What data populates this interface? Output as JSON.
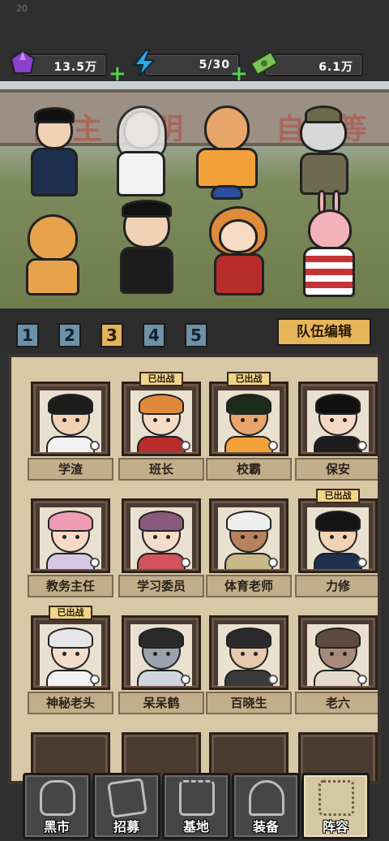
{
  "status_bar": {
    "time_fragment": "20"
  },
  "resources": [
    {
      "icon": "gem-icon",
      "value": "13.5万",
      "color": "#8b3fcf"
    },
    {
      "icon": "lightning-icon",
      "value": "5/30",
      "color": "#2fa8e6"
    },
    {
      "icon": "cash-icon",
      "value": "6.1万",
      "color": "#5aa84a"
    }
  ],
  "scene": {
    "wall_text_left": "民主",
    "wall_text_mid": "明 利",
    "wall_text_right": "自  等"
  },
  "team_tabs": [
    "1",
    "2",
    "3",
    "4",
    "5"
  ],
  "active_team": "3",
  "edit_team_label": "队伍编辑",
  "roster": [
    {
      "name": "学渣",
      "deployed": false,
      "skin": "#f1d2b5",
      "hair": "#1d1d1d",
      "shirt": "#f2f2f2"
    },
    {
      "name": "班长",
      "deployed": true,
      "badge": "已出战",
      "skin": "#f6dcc4",
      "hair": "#e08a3c",
      "shirt": "#b82c2c"
    },
    {
      "name": "校霸",
      "deployed": true,
      "badge": "已出战",
      "skin": "#e8a66b",
      "hair": "#1b2b1c",
      "shirt": "#f3a13a"
    },
    {
      "name": "保安",
      "deployed": false,
      "skin": "#f4d8c3",
      "hair": "#111111",
      "shirt": "#1c1c1c"
    },
    {
      "name": "教务主任",
      "deployed": false,
      "skin": "#f6d9c6",
      "hair": "#ef9cb6",
      "shirt": "#d8c7e4"
    },
    {
      "name": "学习委员",
      "deployed": false,
      "skin": "#f4dcc8",
      "hair": "#8a5a7c",
      "shirt": "#d3535b"
    },
    {
      "name": "体育老师",
      "deployed": false,
      "skin": "#b7835f",
      "hair": "#eeeeee",
      "shirt": "#c9b88a"
    },
    {
      "name": "力修",
      "deployed": true,
      "badge": "已出战",
      "skin": "#f1d2b5",
      "hair": "#151515",
      "shirt": "#1f2f4f"
    },
    {
      "name": "神秘老头",
      "deployed": true,
      "badge": "已出战",
      "skin": "#f3ddcc",
      "hair": "#e6e6e6",
      "shirt": "#f2f2f2"
    },
    {
      "name": "呆呆鹤",
      "deployed": false,
      "skin": "#9aa3ad",
      "hair": "#2a2a2a",
      "shirt": "#cfd6de"
    },
    {
      "name": "百晓生",
      "deployed": false,
      "skin": "#e7c9ad",
      "hair": "#2b2b2b",
      "shirt": "#3a3a3a"
    },
    {
      "name": "老六",
      "deployed": false,
      "skin": "#a98a7a",
      "hair": "#5e4a40",
      "shirt": "#e5d9cc"
    }
  ],
  "bottom_nav": [
    {
      "label": "黑市",
      "icon": "bag-icon",
      "active": false
    },
    {
      "label": "招募",
      "icon": "cards-icon",
      "active": false
    },
    {
      "label": "基地",
      "icon": "castle-icon",
      "active": false
    },
    {
      "label": "装备",
      "icon": "armor-icon",
      "active": false
    },
    {
      "label": "阵容",
      "icon": "lineup-icon",
      "active": true
    }
  ]
}
